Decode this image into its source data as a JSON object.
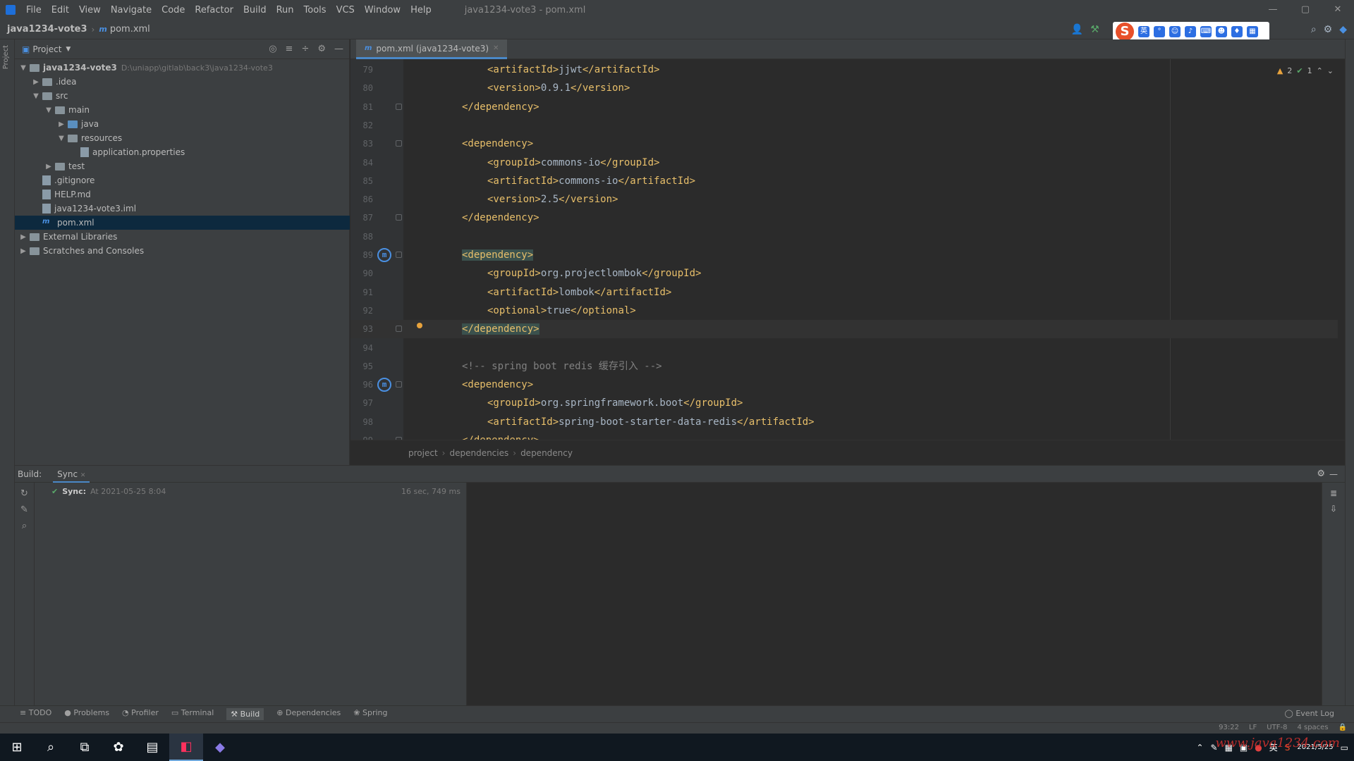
{
  "menu": {
    "items": [
      "File",
      "Edit",
      "View",
      "Navigate",
      "Code",
      "Refactor",
      "Build",
      "Run",
      "Tools",
      "VCS",
      "Window",
      "Help"
    ],
    "window_title": "java1234-vote3 - pom.xml"
  },
  "nav": {
    "project": "java1234-vote3",
    "file": "pom.xml"
  },
  "project_panel": {
    "title": "Project",
    "tree": [
      {
        "label": "java1234-vote3",
        "path": "D:\\uniapp\\gitlab\\back3\\java1234-vote3",
        "depth": 0,
        "type": "module",
        "arrow": "open"
      },
      {
        "label": ".idea",
        "depth": 1,
        "type": "folder",
        "arrow": "closed"
      },
      {
        "label": "src",
        "depth": 1,
        "type": "folder",
        "arrow": "open"
      },
      {
        "label": "main",
        "depth": 2,
        "type": "folder",
        "arrow": "open"
      },
      {
        "label": "java",
        "depth": 3,
        "type": "folder-blue",
        "arrow": "closed"
      },
      {
        "label": "resources",
        "depth": 3,
        "type": "folder",
        "arrow": "open"
      },
      {
        "label": "application.properties",
        "depth": 4,
        "type": "file",
        "arrow": "none"
      },
      {
        "label": "test",
        "depth": 2,
        "type": "folder",
        "arrow": "closed"
      },
      {
        "label": ".gitignore",
        "depth": 1,
        "type": "file",
        "arrow": "none"
      },
      {
        "label": "HELP.md",
        "depth": 1,
        "type": "file",
        "arrow": "none"
      },
      {
        "label": "java1234-vote3.iml",
        "depth": 1,
        "type": "file",
        "arrow": "none"
      },
      {
        "label": "pom.xml",
        "depth": 1,
        "type": "xml",
        "arrow": "none",
        "selected": true
      },
      {
        "label": "External Libraries",
        "depth": 0,
        "type": "folder",
        "arrow": "closed"
      },
      {
        "label": "Scratches and Consoles",
        "depth": 0,
        "type": "folder",
        "arrow": "closed"
      }
    ]
  },
  "editor": {
    "tab_label": "pom.xml (java1234-vote3)",
    "inspection": {
      "warnings": "2",
      "ok": "1"
    },
    "lines": [
      {
        "n": "79",
        "indent": 2,
        "parts": [
          [
            "tag",
            "<artifactId>"
          ],
          [
            "txt",
            "jjwt"
          ],
          [
            "tag",
            "</artifactId>"
          ]
        ]
      },
      {
        "n": "80",
        "indent": 2,
        "parts": [
          [
            "tag",
            "<version>"
          ],
          [
            "txt",
            "0.9.1"
          ],
          [
            "tag",
            "</version>"
          ]
        ]
      },
      {
        "n": "81",
        "indent": 1,
        "parts": [
          [
            "tag",
            "</dependency>"
          ]
        ],
        "fold": true
      },
      {
        "n": "82",
        "indent": 0,
        "parts": []
      },
      {
        "n": "83",
        "indent": 1,
        "parts": [
          [
            "tag",
            "<dependency>"
          ]
        ],
        "fold": true
      },
      {
        "n": "84",
        "indent": 2,
        "parts": [
          [
            "tag",
            "<groupId>"
          ],
          [
            "txt",
            "commons-io"
          ],
          [
            "tag",
            "</groupId>"
          ]
        ]
      },
      {
        "n": "85",
        "indent": 2,
        "parts": [
          [
            "tag",
            "<artifactId>"
          ],
          [
            "txt",
            "commons-io"
          ],
          [
            "tag",
            "</artifactId>"
          ]
        ]
      },
      {
        "n": "86",
        "indent": 2,
        "parts": [
          [
            "tag",
            "<version>"
          ],
          [
            "txt",
            "2.5"
          ],
          [
            "tag",
            "</version>"
          ]
        ]
      },
      {
        "n": "87",
        "indent": 1,
        "parts": [
          [
            "tag",
            "</dependency>"
          ]
        ],
        "fold": true
      },
      {
        "n": "88",
        "indent": 0,
        "parts": []
      },
      {
        "n": "89",
        "indent": 1,
        "parts": [
          [
            "hl",
            "<dependency>"
          ]
        ],
        "fold": true,
        "mark": true
      },
      {
        "n": "90",
        "indent": 2,
        "parts": [
          [
            "tag",
            "<groupId>"
          ],
          [
            "txt",
            "org.projectlombok"
          ],
          [
            "tag",
            "</groupId>"
          ]
        ]
      },
      {
        "n": "91",
        "indent": 2,
        "parts": [
          [
            "tag",
            "<artifactId>"
          ],
          [
            "txt",
            "lombok"
          ],
          [
            "tag",
            "</artifactId>"
          ]
        ]
      },
      {
        "n": "92",
        "indent": 2,
        "parts": [
          [
            "tag",
            "<optional>"
          ],
          [
            "txt",
            "true"
          ],
          [
            "tag",
            "</optional>"
          ]
        ]
      },
      {
        "n": "93",
        "indent": 1,
        "parts": [
          [
            "hl",
            "</dependency>"
          ]
        ],
        "fold": true,
        "current": true,
        "bulb": true
      },
      {
        "n": "94",
        "indent": 0,
        "parts": []
      },
      {
        "n": "95",
        "indent": 1,
        "parts": [
          [
            "cmt",
            "<!-- spring boot redis 缓存引入 -->"
          ]
        ]
      },
      {
        "n": "96",
        "indent": 1,
        "parts": [
          [
            "tag",
            "<dependency>"
          ]
        ],
        "fold": true,
        "mark": true
      },
      {
        "n": "97",
        "indent": 2,
        "parts": [
          [
            "tag",
            "<groupId>"
          ],
          [
            "txt",
            "org.springframework.boot"
          ],
          [
            "tag",
            "</groupId>"
          ]
        ]
      },
      {
        "n": "98",
        "indent": 2,
        "parts": [
          [
            "tag",
            "<artifactId>"
          ],
          [
            "txt",
            "spring-boot-starter-data-redis"
          ],
          [
            "tag",
            "</artifactId>"
          ]
        ]
      },
      {
        "n": "99",
        "indent": 1,
        "parts": [
          [
            "tag",
            "</dependency>"
          ]
        ],
        "fold": true
      }
    ],
    "breadcrumbs": [
      "project",
      "dependencies",
      "dependency"
    ]
  },
  "build": {
    "label": "Build:",
    "tab": "Sync",
    "sync_row": {
      "label": "Sync:",
      "time": "At 2021-05-25 8:04",
      "duration": "16 sec, 749 ms"
    }
  },
  "tool_windows": [
    "TODO",
    "Problems",
    "Profiler",
    "Terminal",
    "Build",
    "Dependencies",
    "Spring"
  ],
  "event_log": "Event Log",
  "status": {
    "position": "93:22",
    "line_sep": "LF",
    "encoding": "UTF-8",
    "indent": "4 spaces"
  },
  "taskbar": {
    "date": "2021/5/25",
    "lang": "英"
  },
  "watermark": "www.java1234.com",
  "ime_logo": "S"
}
